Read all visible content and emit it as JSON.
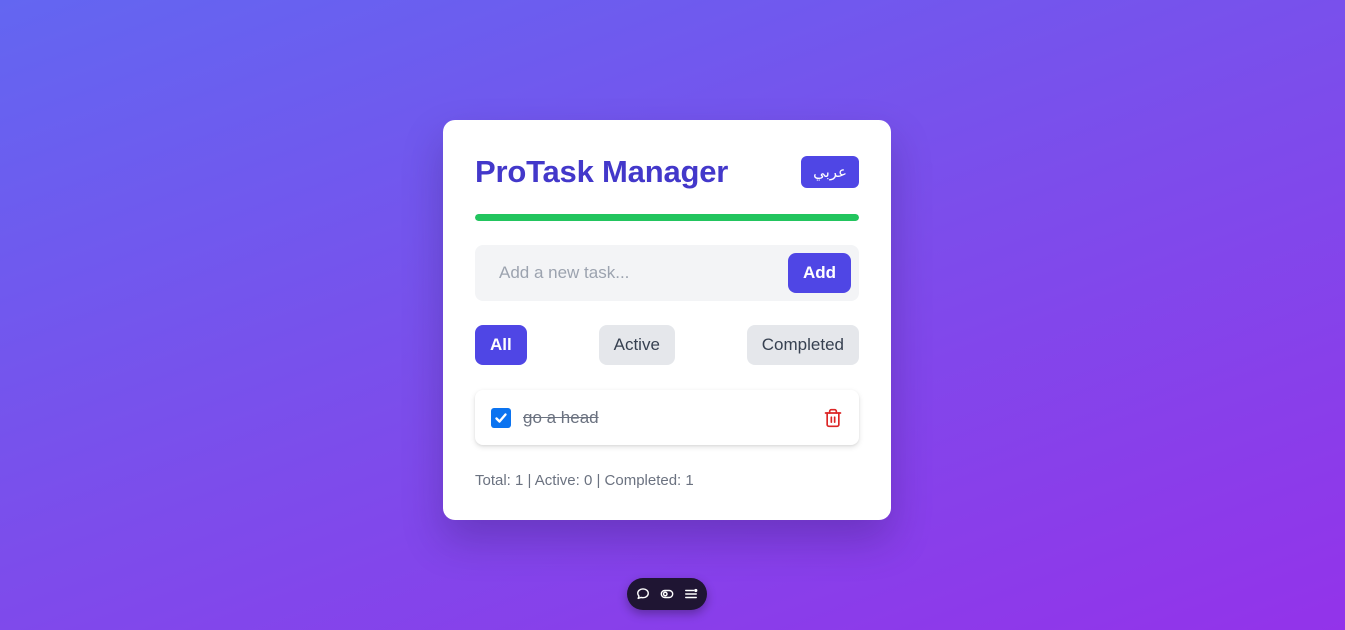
{
  "app": {
    "title": "ProTask Manager",
    "language_button": "عربي",
    "progress_fraction": 1.0
  },
  "add_task": {
    "placeholder": "Add a new task...",
    "value": "",
    "add_label": "Add"
  },
  "filters": [
    {
      "label": "All",
      "active": true
    },
    {
      "label": "Active",
      "active": false
    },
    {
      "label": "Completed",
      "active": false
    }
  ],
  "tasks": [
    {
      "text": "go a head",
      "completed": true
    }
  ],
  "stats": {
    "text": "Total: 1 | Active: 0 | Completed: 1"
  },
  "toolbar": {
    "icons": [
      "comment-icon",
      "toggle-icon",
      "menu-icon"
    ]
  },
  "colors": {
    "accent": "#4f46e5",
    "title": "#4338ca",
    "progress": "#22c55e",
    "delete": "#dc2626",
    "checkbox": "#0b73f0"
  }
}
